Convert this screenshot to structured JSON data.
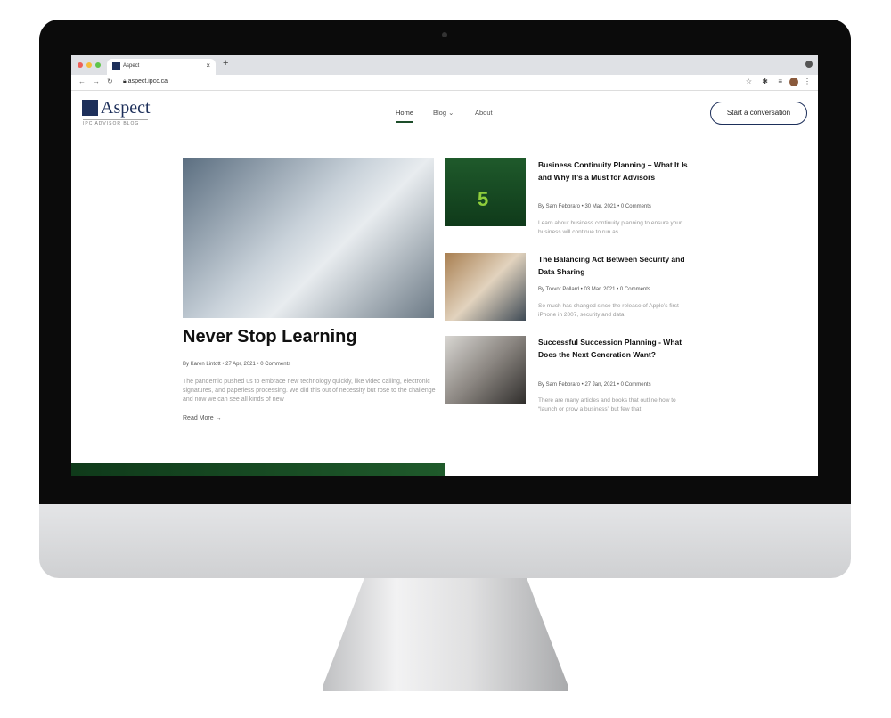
{
  "browser": {
    "tab_title": "Aspect",
    "url": "aspect.ipcc.ca",
    "close": "×",
    "new_tab": "+"
  },
  "site": {
    "brand": "Aspect",
    "tagline": "IPC ADVISOR BLOG",
    "menu": [
      "Home",
      "Blog",
      "About"
    ],
    "cta": "Start a conversation"
  },
  "featured": {
    "title": "Never Stop Learning",
    "meta": "By Karen Lintott • 27 Apr, 2021 • 0 Comments",
    "excerpt": "The pandemic pushed us to embrace new technology quickly, like video calling, electronic signatures, and paperless processing. We did this out of necessity but rose to the challenge and now we can see all kinds of new",
    "read_more": "Read More →"
  },
  "posts": [
    {
      "title": "Business Continuity Planning – What It Is and Why It’s a Must for Advisors",
      "meta": "By Sam Febbraro • 30 Mar, 2021 • 0 Comments",
      "excerpt": "Learn about business continuity planning to ensure your business will continue to run as",
      "thumb_label": "5"
    },
    {
      "title": "The Balancing Act Between Security and Data Sharing",
      "meta": "By Trevor Pollard • 03 Mar, 2021 • 0 Comments",
      "excerpt": "So much has changed since the release of Apple’s first iPhone in 2007, security and data"
    },
    {
      "title": "Successful Succession Planning - What Does the Next Generation Want?",
      "meta": "By Sam Febbraro • 27 Jan, 2021 • 0 Comments",
      "excerpt": "There are many articles and books that outline how to “launch or grow a business” but few that"
    }
  ],
  "colors": {
    "brand": "#1d2f5a",
    "accent_green": "#1d4d2a"
  }
}
